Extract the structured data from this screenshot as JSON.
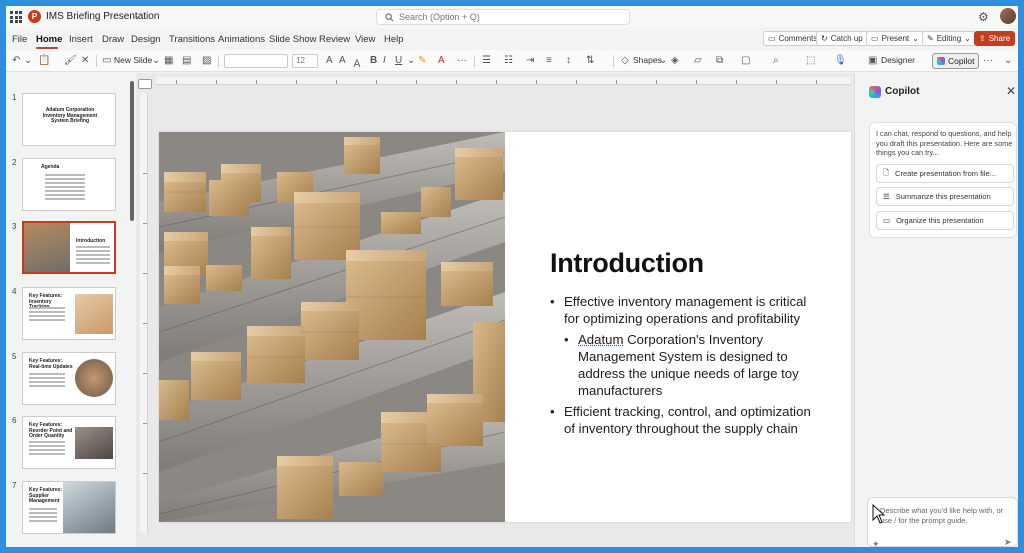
{
  "window": {
    "title": "IMS Briefing Presentation",
    "search_placeholder": "Search (Option + Q)",
    "app_badge": "P"
  },
  "menu": {
    "tabs": [
      "File",
      "Home",
      "Insert",
      "Draw",
      "Design",
      "Transitions",
      "Animations",
      "Slide Show",
      "Review",
      "View",
      "Help"
    ],
    "active_tab": "Home",
    "comments": "Comments",
    "catch_up": "Catch up",
    "present": "Present",
    "editing": "Editing",
    "share": "Share"
  },
  "ribbon": {
    "new_slide": "New Slide",
    "font_size": "12",
    "shapes": "Shapes",
    "designer": "Designer",
    "copilot": "Copilot"
  },
  "slides": [
    {
      "num": "1",
      "title": "Adatum Corporation Inventory Management System Briefing"
    },
    {
      "num": "2",
      "title": "Agenda"
    },
    {
      "num": "3",
      "title": "Introduction"
    },
    {
      "num": "4",
      "title": "Key Features: Inventory Tracking"
    },
    {
      "num": "5",
      "title": "Key Features: Real-time Updates"
    },
    {
      "num": "6",
      "title": "Key Features: Reorder Point and Order Quantity"
    },
    {
      "num": "7",
      "title": "Key Features: Supplier Management"
    }
  ],
  "selected_slide": "3",
  "current_slide": {
    "heading": "Introduction",
    "bullets": [
      {
        "level": 1,
        "text": "Effective inventory management is critical for optimizing operations and profitability"
      },
      {
        "level": 2,
        "prefix": "Adatum",
        "text": " Corporation's Inventory Management System is designed to address the unique needs of large toy manufacturers"
      },
      {
        "level": 1,
        "text": "Efficient tracking, control, and optimization of inventory throughout the supply chain"
      }
    ]
  },
  "copilot": {
    "title": "Copilot",
    "intro": "I can chat, respond to questions, and help you draft this presentation. Here are some things you can try...",
    "suggestions": [
      "Create presentation from file...",
      "Summarize this presentation",
      "Organize this presentation"
    ],
    "input_placeholder": "Describe what you'd like help with, or use / for the prompt guide."
  },
  "colors": {
    "accent": "#c43e1c",
    "frame": "#2e8fe0"
  }
}
